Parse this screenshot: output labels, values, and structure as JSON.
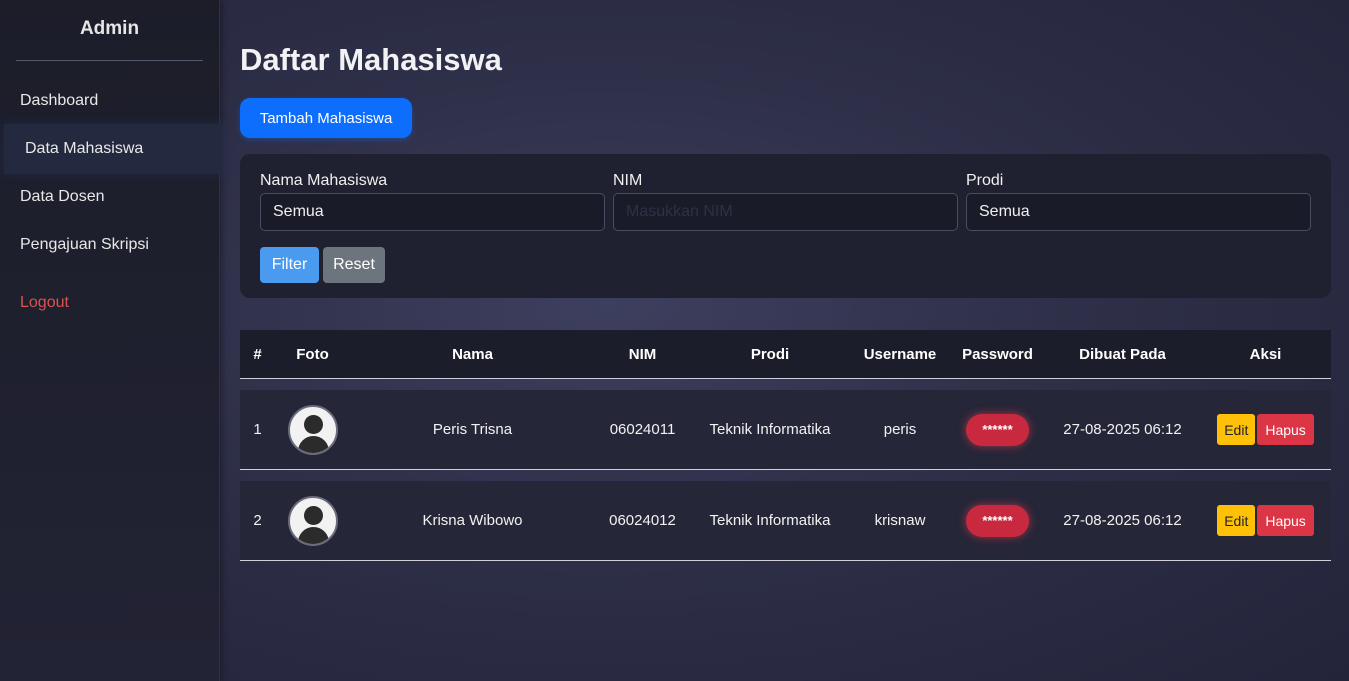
{
  "sidebar": {
    "title": "Admin",
    "items": [
      {
        "label": "Dashboard"
      },
      {
        "label": "Data Mahasiswa"
      },
      {
        "label": "Data Dosen"
      },
      {
        "label": "Pengajuan Skripsi"
      }
    ],
    "logout": "Logout"
  },
  "main": {
    "title": "Daftar Mahasiswa",
    "add_button": "Tambah Mahasiswa"
  },
  "filter": {
    "name_label": "Nama Mahasiswa",
    "name_value": "Semua",
    "nim_label": "NIM",
    "nim_placeholder": "Masukkan NIM",
    "prodi_label": "Prodi",
    "prodi_value": "Semua",
    "filter_button": "Filter",
    "reset_button": "Reset"
  },
  "table": {
    "headers": [
      "#",
      "Foto",
      "Nama",
      "NIM",
      "Prodi",
      "Username",
      "Password",
      "Dibuat Pada",
      "Aksi"
    ],
    "rows": [
      {
        "no": "1",
        "nama": "Peris Trisna",
        "nim": "06024011",
        "prodi": "Teknik Informatika",
        "username": "peris",
        "password": "******",
        "created": "27-08-2025 06:12",
        "edit": "Edit",
        "hapus": "Hapus"
      },
      {
        "no": "2",
        "nama": "Krisna Wibowo",
        "nim": "06024012",
        "prodi": "Teknik Informatika",
        "username": "krisnaw",
        "password": "******",
        "created": "27-08-2025 06:12",
        "edit": "Edit",
        "hapus": "Hapus"
      }
    ]
  },
  "icons": {
    "avatar": "user-avatar-icon"
  },
  "colors": {
    "primary": "#0d6efd",
    "danger": "#dc3545",
    "warning": "#ffc107",
    "secondary": "#6c757d"
  }
}
